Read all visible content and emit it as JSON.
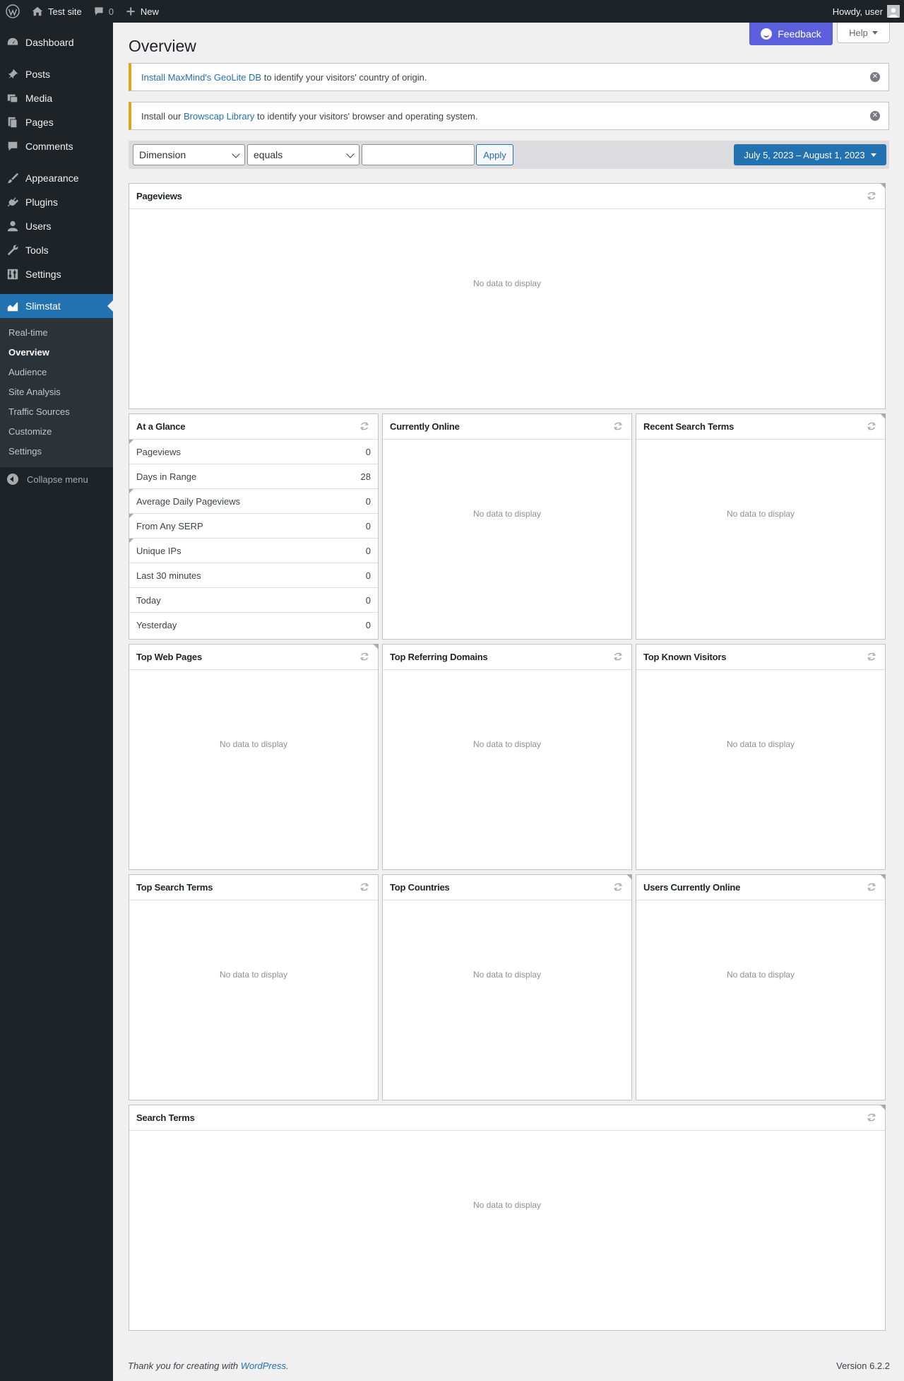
{
  "adminbar": {
    "site_name": "Test site",
    "comments_count": "0",
    "new_label": "New",
    "howdy": "Howdy, user"
  },
  "sidebar": {
    "items": [
      {
        "label": "Dashboard",
        "icon": "dashboard-icon"
      },
      {
        "label": "Posts",
        "icon": "pin-icon"
      },
      {
        "label": "Media",
        "icon": "media-icon"
      },
      {
        "label": "Pages",
        "icon": "pages-icon"
      },
      {
        "label": "Comments",
        "icon": "comment-icon"
      },
      {
        "label": "Appearance",
        "icon": "paintbrush-icon"
      },
      {
        "label": "Plugins",
        "icon": "plug-icon"
      },
      {
        "label": "Users",
        "icon": "user-icon"
      },
      {
        "label": "Tools",
        "icon": "wrench-icon"
      },
      {
        "label": "Settings",
        "icon": "settings-icon"
      },
      {
        "label": "Slimstat",
        "icon": "chart-icon"
      }
    ],
    "submenu": [
      "Real-time",
      "Overview",
      "Audience",
      "Site Analysis",
      "Traffic Sources",
      "Customize",
      "Settings"
    ],
    "collapse_label": "Collapse menu"
  },
  "header": {
    "title": "Overview",
    "feedback_label": "Feedback",
    "help_label": "Help"
  },
  "notices": [
    {
      "link": "Install MaxMind's GeoLite DB",
      "prefix": "",
      "text": " to identify your visitors' country of origin."
    },
    {
      "prefix": "Install our ",
      "link": "Browscap Library",
      "text": " to identify your visitors' browser and operating system."
    }
  ],
  "filters": {
    "dimension": "Dimension",
    "operator": "equals",
    "value": "",
    "apply_label": "Apply",
    "date_range": "July 5, 2023 – August 1, 2023"
  },
  "empty_text": "No data to display",
  "boxes": {
    "pageviews": "Pageviews",
    "glance": "At a Glance",
    "online": "Currently Online",
    "recent_search": "Recent Search Terms",
    "top_pages": "Top Web Pages",
    "referring": "Top Referring Domains",
    "known_visitors": "Top Known Visitors",
    "top_search": "Top Search Terms",
    "countries": "Top Countries",
    "users_online": "Users Currently Online",
    "search_terms": "Search Terms"
  },
  "glance_rows": [
    {
      "label": "Pageviews",
      "value": "0"
    },
    {
      "label": "Days in Range",
      "value": "28"
    },
    {
      "label": "Average Daily Pageviews",
      "value": "0"
    },
    {
      "label": "From Any SERP",
      "value": "0"
    },
    {
      "label": "Unique IPs",
      "value": "0"
    },
    {
      "label": "Last 30 minutes",
      "value": "0"
    },
    {
      "label": "Today",
      "value": "0"
    },
    {
      "label": "Yesterday",
      "value": "0"
    }
  ],
  "footer": {
    "thanks_prefix": "Thank you for creating with ",
    "thanks_link": "WordPress",
    "thanks_suffix": ".",
    "version": "Version 6.2.2"
  },
  "colors": {
    "admin_bg": "#1d2327",
    "accent": "#2271b1",
    "feedback": "#5b5fdb",
    "notice_warning": "#dba617"
  }
}
